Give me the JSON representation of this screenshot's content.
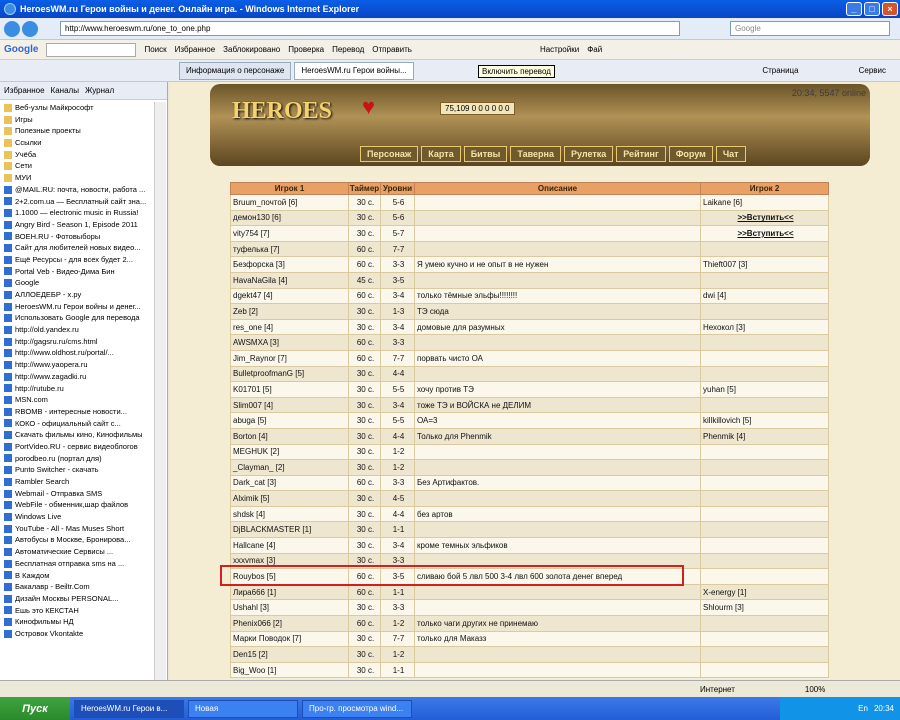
{
  "window": {
    "title": "HeroesWM.ru Герои войны и денег. Онлайн игра. - Windows Internet Explorer"
  },
  "address": {
    "url": "http://www.heroeswm.ru/one_to_one.php",
    "search_placeholder": "Google"
  },
  "google_toolbar": {
    "logo": "Google",
    "items": [
      "Поиск",
      "Избранное",
      "Заблокировано",
      "Проверка",
      "Перевод",
      "Отправить",
      "Настройки",
      "Фай"
    ]
  },
  "tabs": [
    {
      "label": "Информация о персонаже"
    },
    {
      "label": "HeroesWM.ru Герои войны..."
    }
  ],
  "tooltip": "Включить перевод",
  "toolbar_right": {
    "page": "Страница",
    "service": "Сервис"
  },
  "sidebar": {
    "head": [
      "Избранное",
      "Каналы",
      "Журнал"
    ],
    "items": [
      "Веб-узлы Майкрософт",
      "Игры",
      "Полезные проекты",
      "Ссылки",
      "Учёба",
      "Сети",
      "МУИ",
      "@MAIL.RU: почта, новости, работа ...",
      "2+2.com.ua — Бесплатный сайт зна...",
      "1.1000 — electronic music in Russia!",
      "Angry Bird - Season 1, Episode 2011",
      "ВОЕН.RU - Фотовыборы",
      "Сайт для любителей новых видео...",
      "Ещё Ресурсы - для всех будет 2...",
      "Portal Veb - Видео-Дима Бин",
      "Google",
      "АЛЛОЕДЕБР - х.ру",
      "HeroesWM.ru Герои войны и денег...",
      "Использовать Google для перевода",
      "http://old.yandex.ru",
      "http://gagsru.ru/cms.html",
      "http://www.oldhost.ru/portal/...",
      "http://www.yaopera.ru",
      "http://www.zagadki.ru",
      "http://rutube.ru",
      "MSN.com",
      "RBOMB - интересные новости...",
      "КОКО - официальный сайт с...",
      "Скачать фильмы кино, Кинофильмы",
      "PortVideo.RU - сервис видеоблогов",
      "porodbeo.ru (портал для)",
      "Punto Switcher - скачать",
      "Rambler Search",
      "Webmail - Отправка SMS",
      "WebFile - обменник,шар файлов",
      "Windows Live",
      "YouTube - All - Mas Muses Short",
      "Автобусы в Москве, Бронирова...",
      "Автоматические Сервисы ...",
      "Бесплатная отправка sms на ...",
      "В Каждом",
      "Бакалавр - Beiltr.Com",
      "Дизайн Москвы PERSONAL...",
      "Ешь это КЕКСТАН",
      "Кинофильмы НД",
      "Островок Vkontakte"
    ]
  },
  "banner": {
    "logo": "HEROES",
    "resources": "75,109  0  0  0  0  0  0",
    "time": "20:34, 5547 online",
    "menu": [
      "Персонаж",
      "Карта",
      "Битвы",
      "Таверна",
      "Рулетка",
      "Рейтинг",
      "Форум",
      "Чат"
    ]
  },
  "table": {
    "headers": [
      "Игрок 1",
      "Таймер",
      "Уровни",
      "Описание",
      "Игрок 2"
    ],
    "rows": [
      [
        "Bruum_почтой [6]",
        "30 с.",
        "5-6",
        "",
        "Laikane [6]"
      ],
      [
        "демон130 [6]",
        "30 с.",
        "5-6",
        "",
        ">>Вступить<<"
      ],
      [
        "vity754 [7]",
        "30 с.",
        "5-7",
        "",
        ">>Вступить<<"
      ],
      [
        "туфелька [7]",
        "60 с.",
        "7-7",
        "",
        ""
      ],
      [
        "Безфорска [3]",
        "60 с.",
        "3-3",
        "Я умею кучно и не опыт в не нужен",
        "Thieft007 [3]"
      ],
      [
        "HavaNaGila [4]",
        "45 с.",
        "3-5",
        "",
        ""
      ],
      [
        "dgekt47 [4]",
        "60 с.",
        "3-4",
        "только тёмные эльфы!!!!!!!!",
        "dwi [4]"
      ],
      [
        "Zeb [2]",
        "30 с.",
        "1-3",
        "ТЭ сюда",
        ""
      ],
      [
        "res_one [4]",
        "30 с.",
        "3-4",
        "домовые для разумных",
        "Нехокол [3]"
      ],
      [
        "AWSMXA [3]",
        "60 с.",
        "3-3",
        "",
        ""
      ],
      [
        "Jim_Raynor [7]",
        "60 с.",
        "7-7",
        "порвать чисто ОА",
        ""
      ],
      [
        "BulletproofmanG [5]",
        "30 с.",
        "4-4",
        "",
        ""
      ],
      [
        "K01701 [5]",
        "30 с.",
        "5-5",
        "хочу против ТЭ",
        "yuhan [5]"
      ],
      [
        "Slim007 [4]",
        "30 с.",
        "3-4",
        "тоже ТЭ и ВОЙСКА не ДЕЛИМ",
        ""
      ],
      [
        "abuga [5]",
        "30 с.",
        "5-5",
        "ОА=3",
        "killkillovich [5]"
      ],
      [
        "Borton [4]",
        "30 с.",
        "4-4",
        "Только для Phenmik",
        "Phenmik [4]"
      ],
      [
        "MEGHUK [2]",
        "30 с.",
        "1-2",
        "",
        ""
      ],
      [
        "_Clayman_ [2]",
        "30 с.",
        "1-2",
        "",
        ""
      ],
      [
        "Dark_cat [3]",
        "60 с.",
        "3-3",
        "Без Артифактов.",
        ""
      ],
      [
        "Alximik [5]",
        "30 с.",
        "4-5",
        "",
        ""
      ],
      [
        "shdsk [4]",
        "30 с.",
        "4-4",
        "без артов",
        ""
      ],
      [
        "DjBLACKMASTER [1]",
        "30 с.",
        "1-1",
        "",
        ""
      ],
      [
        "Наllcane [4]",
        "30 с.",
        "3-4",
        "кроме темных эльфиков",
        ""
      ],
      [
        "xxxvmax [3]",
        "30 с.",
        "3-3",
        "",
        ""
      ],
      [
        "Rouybos [5]",
        "60 с.",
        "3-5",
        "сливаю бой 5 лвл 500 3-4 лвл 600 золота денег вперед",
        ""
      ],
      [
        "Лира666 [1]",
        "60 с.",
        "1-1",
        "",
        "X-energy [1]"
      ],
      [
        "Ushahl [3]",
        "30 с.",
        "3-3",
        "",
        "Shlourm [3]"
      ],
      [
        "Phenix066 [2]",
        "60 с.",
        "1-2",
        "только чаги других не принемаю",
        ""
      ],
      [
        "Марки Поводок [7]",
        "30 с.",
        "7-7",
        "только для Маказз",
        ""
      ],
      [
        "Den15 [2]",
        "30 с.",
        "1-2",
        "",
        ""
      ],
      [
        "Big_Woo [1]",
        "30 с.",
        "1-1",
        "",
        ""
      ]
    ]
  },
  "statusbar": {
    "zone": "Интернет",
    "zoom": "100%"
  },
  "taskbar": {
    "start": "Пуск",
    "tasks": [
      "HeroesWM.ru Герои в...",
      "Новая",
      "Про-гр. просмотра wind..."
    ],
    "lang": "En",
    "time": "20:34"
  }
}
